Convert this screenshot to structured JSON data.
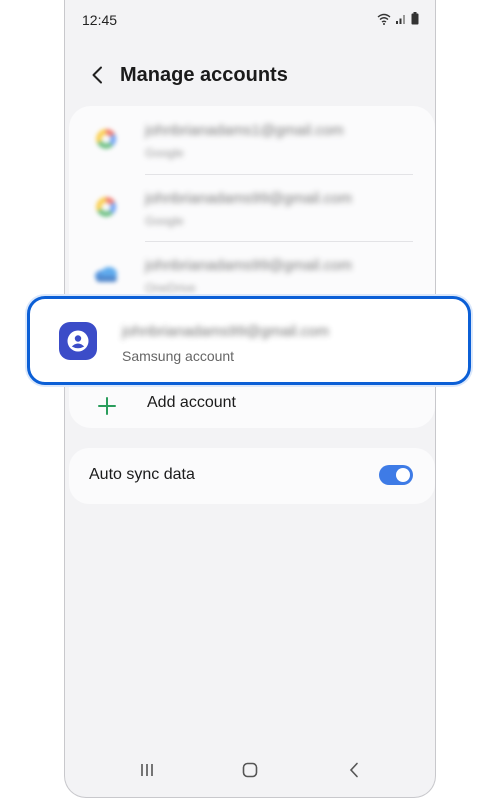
{
  "status_bar": {
    "time": "12:45"
  },
  "header": {
    "title": "Manage accounts"
  },
  "accounts": [
    {
      "email": "johnbrianadams1@gmail.com",
      "type": "Google",
      "icon": "google-icon"
    },
    {
      "email": "johnbrianadams99@gmail.com",
      "type": "Google",
      "icon": "google-icon"
    },
    {
      "email": "johnbrianadams99@gmail.com",
      "type": "OneDrive",
      "icon": "onedrive-icon"
    }
  ],
  "highlighted_account": {
    "email": "johnbrianadams99@gmail.com",
    "type": "Samsung account",
    "icon": "samsung-account-icon"
  },
  "add_account": {
    "label": "Add account"
  },
  "sync": {
    "label": "Auto sync data",
    "enabled": true
  },
  "colors": {
    "accent": "#3e7be6",
    "highlight_border": "#0b5fd6",
    "samsung_icon": "#3b4cc8"
  }
}
